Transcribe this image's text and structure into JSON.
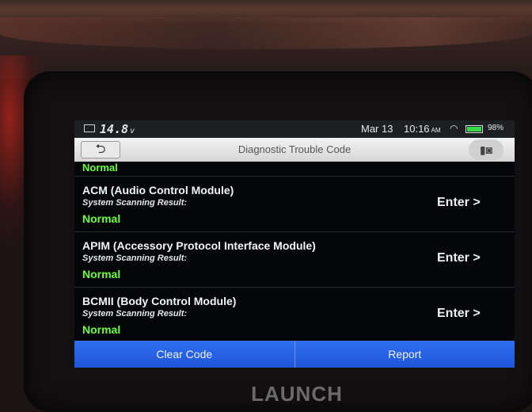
{
  "status": {
    "voltage": "14.8",
    "voltage_unit": "v",
    "date": "Mar 13",
    "time": "10:16",
    "ampm": "AM",
    "battery_pct": "98%",
    "battery_level": 0.98
  },
  "header": {
    "back_label": "⮌",
    "title": "Diagnostic Trouble Code",
    "camera_label": "▮◙"
  },
  "list": {
    "top_partial_result": "Normal",
    "items": [
      {
        "name": "ACM (Audio Control Module)",
        "label": "System Scanning Result:",
        "result": "Normal",
        "enter": "Enter >"
      },
      {
        "name": "APIM (Accessory Protocol Interface Module)",
        "label": "System Scanning Result:",
        "result": "Normal",
        "enter": "Enter >"
      },
      {
        "name": "BCMII (Body Control Module)",
        "label": "System Scanning Result:",
        "result": "Normal",
        "enter": "Enter >"
      }
    ]
  },
  "footer": {
    "clear_code": "Clear Code",
    "report": "Report"
  },
  "brand": "LAUNCH",
  "colors": {
    "accent": "#1f55d8",
    "normal": "#6bff3a"
  }
}
